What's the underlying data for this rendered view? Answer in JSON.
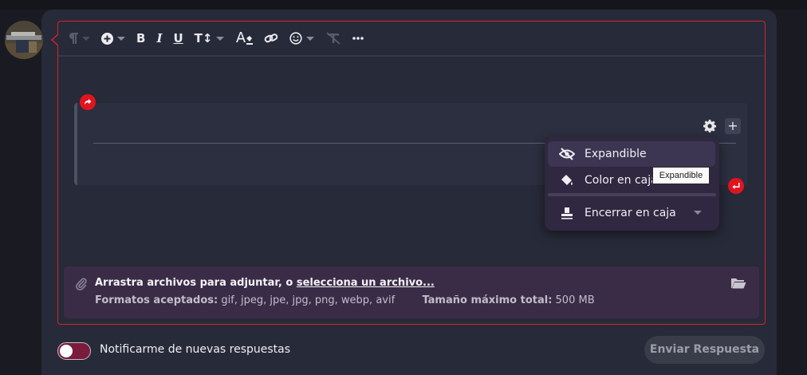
{
  "toolbar": {
    "bold_label": "B",
    "italic_label": "I",
    "underline_label": "U",
    "textsize_label": "T↕",
    "items": [
      "paragraph-icon",
      "insert-icon",
      "bold-icon",
      "italic-icon",
      "underline-icon",
      "text-size-icon",
      "text-color-icon",
      "link-icon",
      "emoji-icon",
      "clear-format-icon",
      "more-icon"
    ]
  },
  "box": {
    "plus_label": "+"
  },
  "menu": {
    "items": [
      {
        "label": "Expandible",
        "icon": "eye-slash-icon"
      },
      {
        "label": "Color en caja",
        "icon": "paint-bucket-icon"
      },
      {
        "label": "Encerrar en caja",
        "icon": "stamp-icon"
      }
    ]
  },
  "tooltip": {
    "text": "Expandible"
  },
  "attach": {
    "drag_text": "Arrastra archivos para adjuntar, o ",
    "select_link": "selecciona un archivo...",
    "formats_label": "Formatos aceptados:",
    "formats_value": " gif, jpeg, jpe, jpg, png, webp, avif",
    "max_label": "Tamaño máximo total:",
    "max_value": " 500 MB"
  },
  "notify": {
    "label": "Notificarme de nuevas respuestas",
    "enabled": false
  },
  "send_button": {
    "label": "Enviar Respuesta"
  },
  "colors": {
    "accent_red": "#d8232a",
    "panel": "#272a38",
    "menu_bg": "#2f2840",
    "attach_bg": "#3a2c47",
    "toggle_track": "#7a1b3c"
  }
}
